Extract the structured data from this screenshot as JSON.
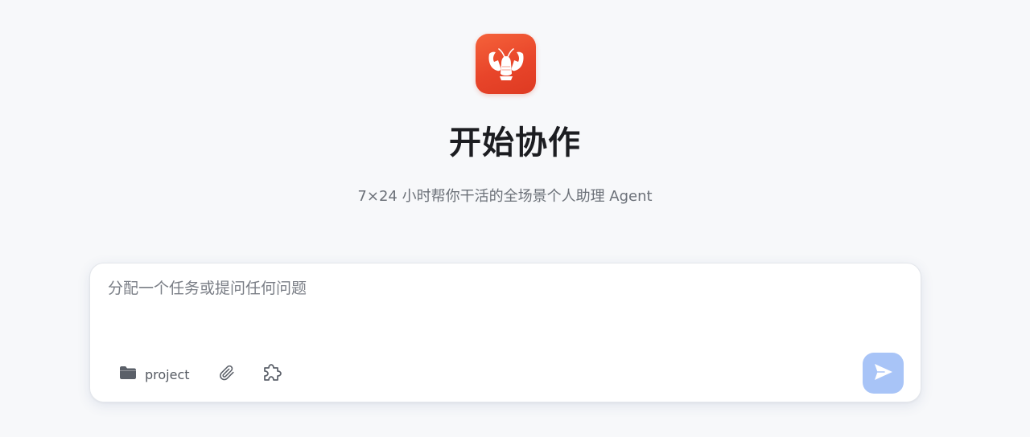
{
  "header": {
    "logo_icon": "lobster-logo-icon",
    "title": "开始协作",
    "subtitle": "7×24 小时帮你干活的全场景个人助理 Agent"
  },
  "composer": {
    "placeholder": "分配一个任务或提问任何问题",
    "value": "",
    "project_label": "project",
    "project_icon": "folder-icon",
    "attach_icon": "paperclip-icon",
    "plugin_icon": "puzzle-icon",
    "send_icon": "send-icon"
  },
  "colors": {
    "background": "#f7f8fa",
    "logo_accent": "#e8452a",
    "send_button": "#a8c4f7",
    "title_text": "#1c1d21",
    "muted_text": "#6b7078"
  }
}
